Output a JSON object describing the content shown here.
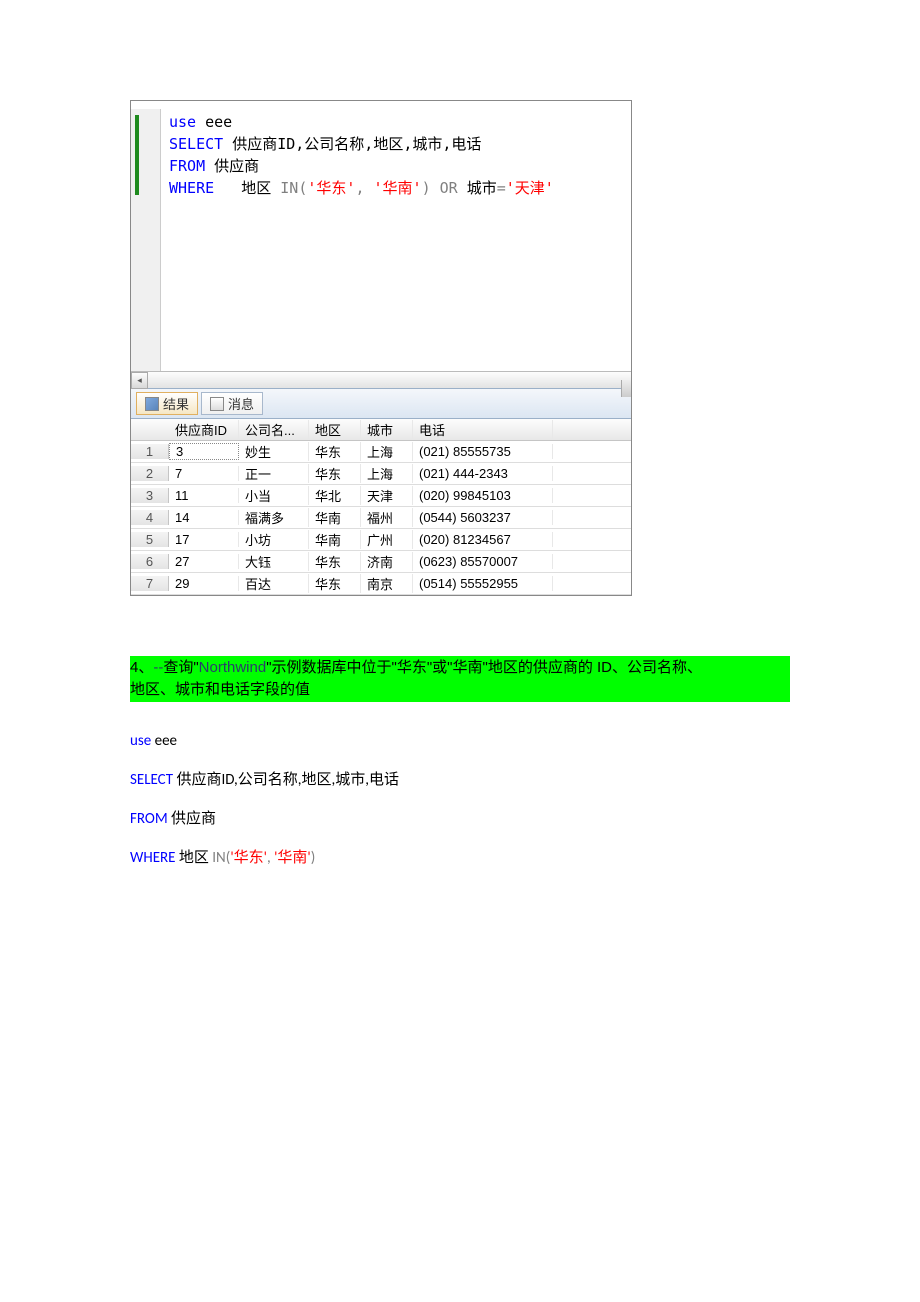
{
  "sql_screenshot": {
    "line1_use": "use",
    "line1_db": " eee",
    "line2_select": "SELECT",
    "line2_cols": " 供应商ID,公司名称,地区,城市,电话",
    "line3_from": "FROM",
    "line3_tbl": " 供应商",
    "line4_where": "WHERE",
    "line4_col": "   地区 ",
    "line4_in": "IN",
    "line4_paren1": "(",
    "line4_str1": "'华东'",
    "line4_comma": ", ",
    "line4_str2": "'华南'",
    "line4_paren2": ") ",
    "line4_or": "OR",
    "line4_city": " 城市",
    "line4_eq": "=",
    "line4_str3": "'天津'"
  },
  "tabs": {
    "results": "结果",
    "messages": "消息"
  },
  "grid": {
    "headers": [
      "供应商ID",
      "公司名...",
      "地区",
      "城市",
      "电话"
    ],
    "rows": [
      [
        "3",
        "妙生",
        "华东",
        "上海",
        "(021) 85555735"
      ],
      [
        "7",
        "正一",
        "华东",
        "上海",
        "(021) 444-2343"
      ],
      [
        "11",
        "小当",
        "华北",
        "天津",
        "(020) 99845103"
      ],
      [
        "14",
        "福满多",
        "华南",
        "福州",
        "(0544) 5603237"
      ],
      [
        "17",
        "小坊",
        "华南",
        "广州",
        "(020) 81234567"
      ],
      [
        "27",
        "大钰",
        "华东",
        "济南",
        "(0623) 85570007"
      ],
      [
        "29",
        "百达",
        "华东",
        "南京",
        "(0514) 55552955"
      ]
    ]
  },
  "question": {
    "prefix": "4、",
    "dashes": "--",
    "text1": "查询\"",
    "northwind": "Northwind",
    "text2": "\"示例数据库中位于\"华东\"或\"华南\"地区的供应商的 ID、公司名称、",
    "line2": "地区、城市和电话字段的值"
  },
  "answer": {
    "use": "use",
    "use_arg": " eee",
    "select": "SELECT",
    "select_cols": "  供应商ID,公司名称,地区,城市,电话",
    "from": "FROM",
    "from_tbl": "  供应商",
    "where": "WHERE",
    "where_col": "   地区 ",
    "in": "IN",
    "paren1": "(",
    "str1": "'华东'",
    "comma": ", ",
    "str2": "'华南'",
    "paren2": ")"
  }
}
